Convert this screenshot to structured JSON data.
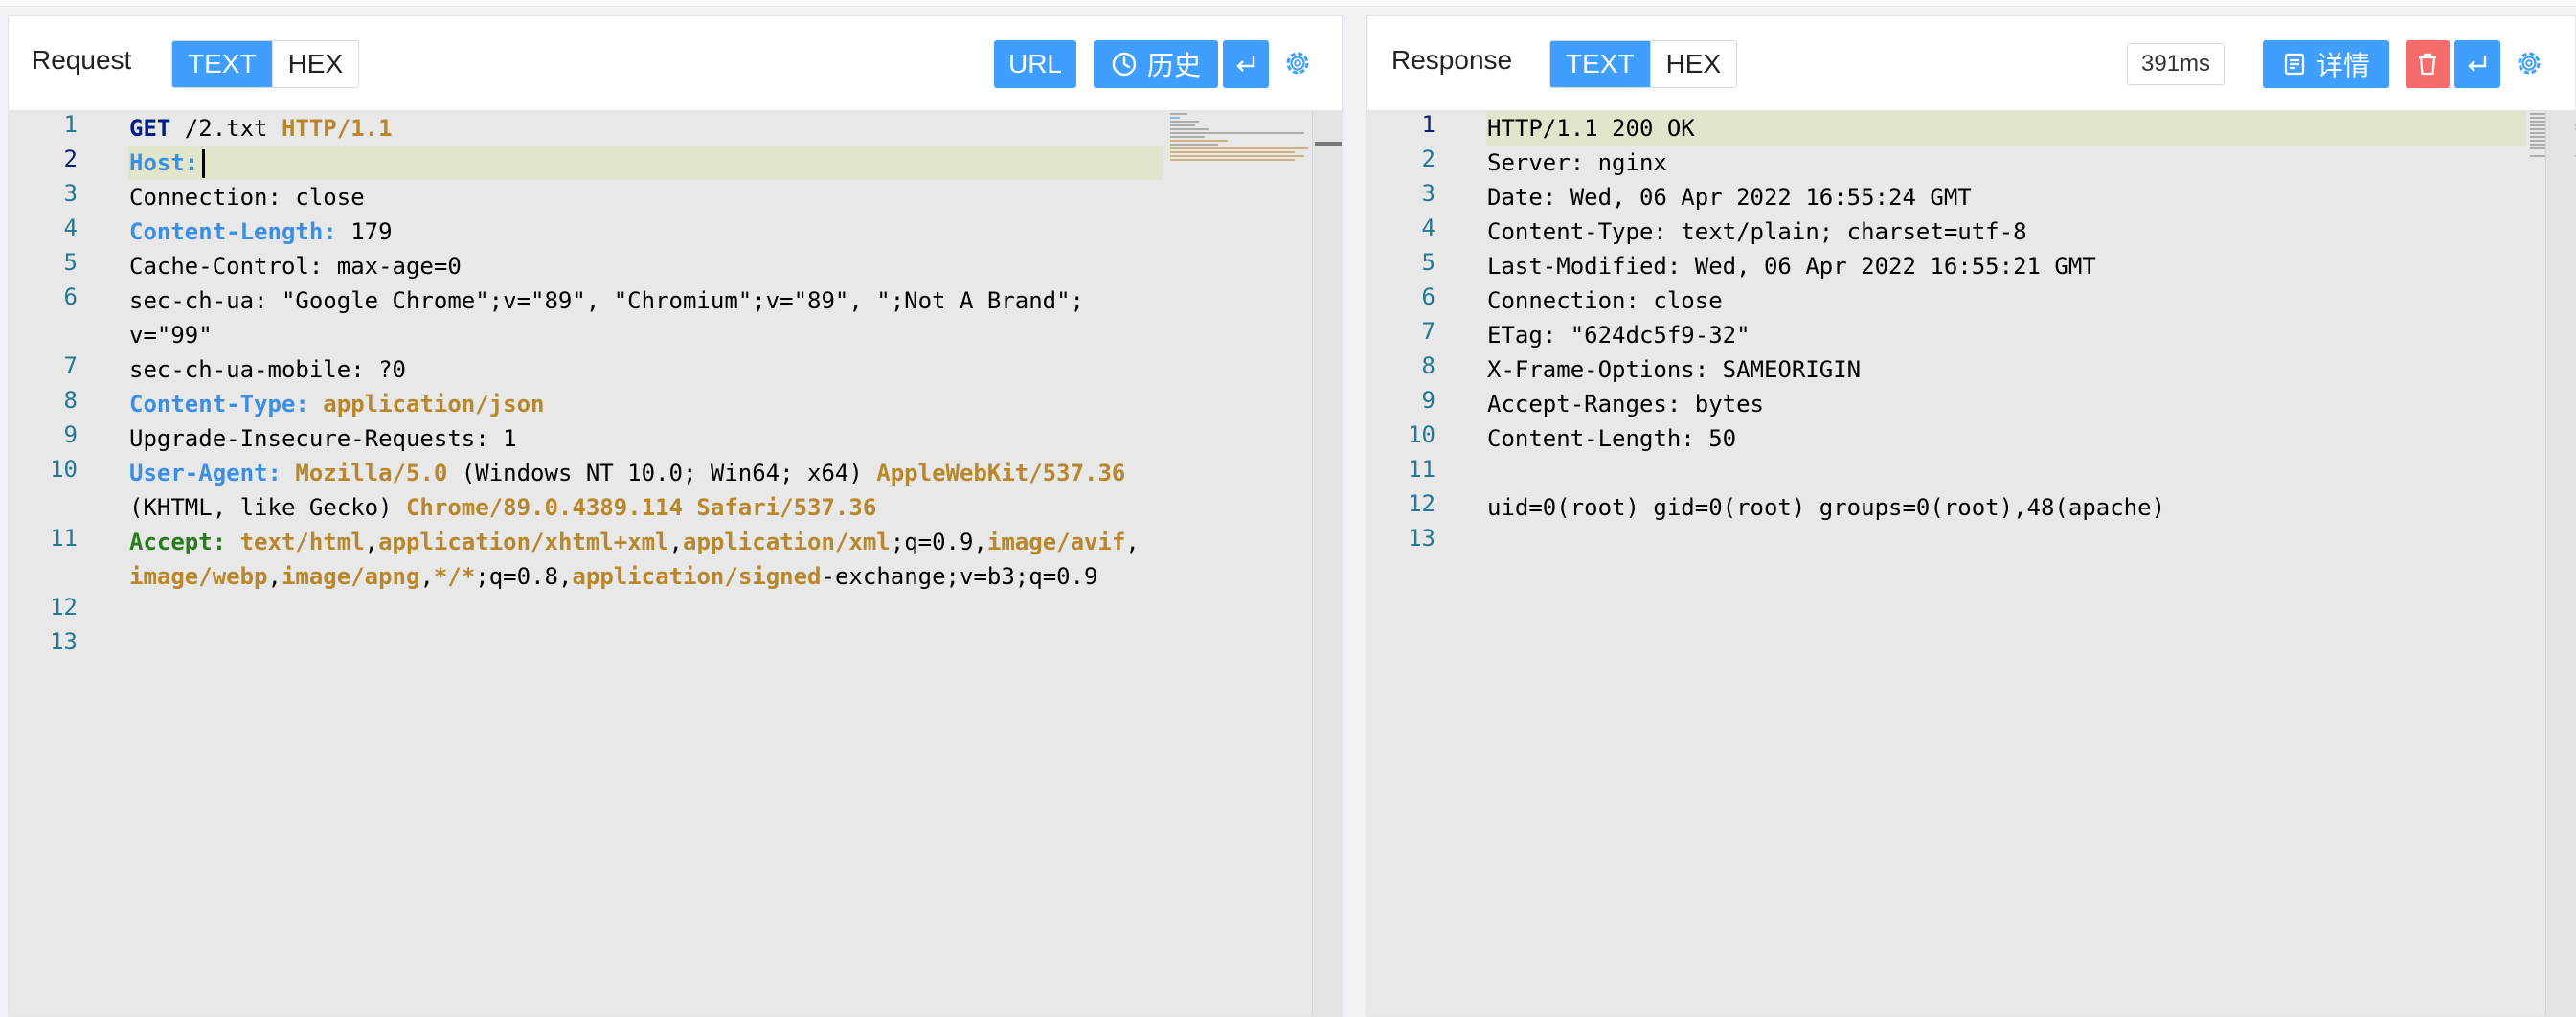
{
  "request": {
    "title": "Request",
    "modes": [
      "TEXT",
      "HEX"
    ],
    "url_button": "URL",
    "history_button": "历史",
    "lines": [
      {
        "n": "1"
      },
      {
        "n": "2"
      },
      {
        "n": "3"
      },
      {
        "n": "4"
      },
      {
        "n": "5"
      },
      {
        "n": "6"
      },
      {
        "n": "7"
      },
      {
        "n": "8"
      },
      {
        "n": "9"
      },
      {
        "n": "10"
      },
      {
        "n": "11"
      },
      {
        "n": "12"
      },
      {
        "n": "13"
      }
    ],
    "code": {
      "l1": [
        "GET",
        " /2.txt ",
        "HTTP/1.1"
      ],
      "l2": [
        "Host:"
      ],
      "l3": "Connection: close",
      "l4": [
        "Content-Length:",
        " 179"
      ],
      "l5": "Cache-Control: max-age=0",
      "l6a": "sec-ch-ua: \"Google Chrome\";v=\"89\", \"Chromium\";v=\"89\", \";Not A Brand\";",
      "l6b": "v=\"99\"",
      "l7": "sec-ch-ua-mobile: ?0",
      "l8": [
        "Content-Type:",
        " application/json"
      ],
      "l9": "Upgrade-Insecure-Requests: 1",
      "l10a": [
        "User-Agent:",
        " Mozilla/5.0",
        " (Windows NT 10.0; Win64; x64) ",
        "AppleWebKit/537.36"
      ],
      "l10b": [
        "(KHTML, like Gecko) ",
        "Chrome/89.0.4389.114",
        " ",
        "Safari/537.36"
      ],
      "l11a": [
        "Accept:",
        " text/html",
        ",",
        "application/xhtml+xml",
        ",",
        "application/xml",
        ";q=0.9,",
        "image/avif",
        ","
      ],
      "l11b": [
        "image/webp",
        ",",
        "image/apng",
        ",",
        "*/*",
        ";q=0.8,",
        "application/signed",
        "-exchange;v=b3;q=0.9"
      ]
    }
  },
  "response": {
    "title": "Response",
    "modes": [
      "TEXT",
      "HEX"
    ],
    "time": "391ms",
    "detail_button": "详情",
    "lines": [
      {
        "n": "1",
        "text": "HTTP/1.1 200 OK"
      },
      {
        "n": "2",
        "text": "Server: nginx"
      },
      {
        "n": "3",
        "text": "Date: Wed, 06 Apr 2022 16:55:24 GMT"
      },
      {
        "n": "4",
        "text": "Content-Type: text/plain; charset=utf-8"
      },
      {
        "n": "5",
        "text": "Last-Modified: Wed, 06 Apr 2022 16:55:21 GMT"
      },
      {
        "n": "6",
        "text": "Connection: close"
      },
      {
        "n": "7",
        "text": "ETag: \"624dc5f9-32\""
      },
      {
        "n": "8",
        "text": "X-Frame-Options: SAMEORIGIN"
      },
      {
        "n": "9",
        "text": "Accept-Ranges: bytes"
      },
      {
        "n": "10",
        "text": "Content-Length: 50"
      },
      {
        "n": "11",
        "text": ""
      },
      {
        "n": "12",
        "text": "uid=0(root) gid=0(root) groups=0(root),48(apache)"
      },
      {
        "n": "13",
        "text": ""
      }
    ]
  },
  "icons": {
    "history": "clock-icon",
    "wrap": "wrap-icon",
    "settings": "gear-icon",
    "detail": "list-icon",
    "delete": "trash-icon"
  },
  "colors": {
    "accent": "#409eff",
    "danger": "#f56c6c",
    "line_highlight": "#e1e5cb"
  }
}
